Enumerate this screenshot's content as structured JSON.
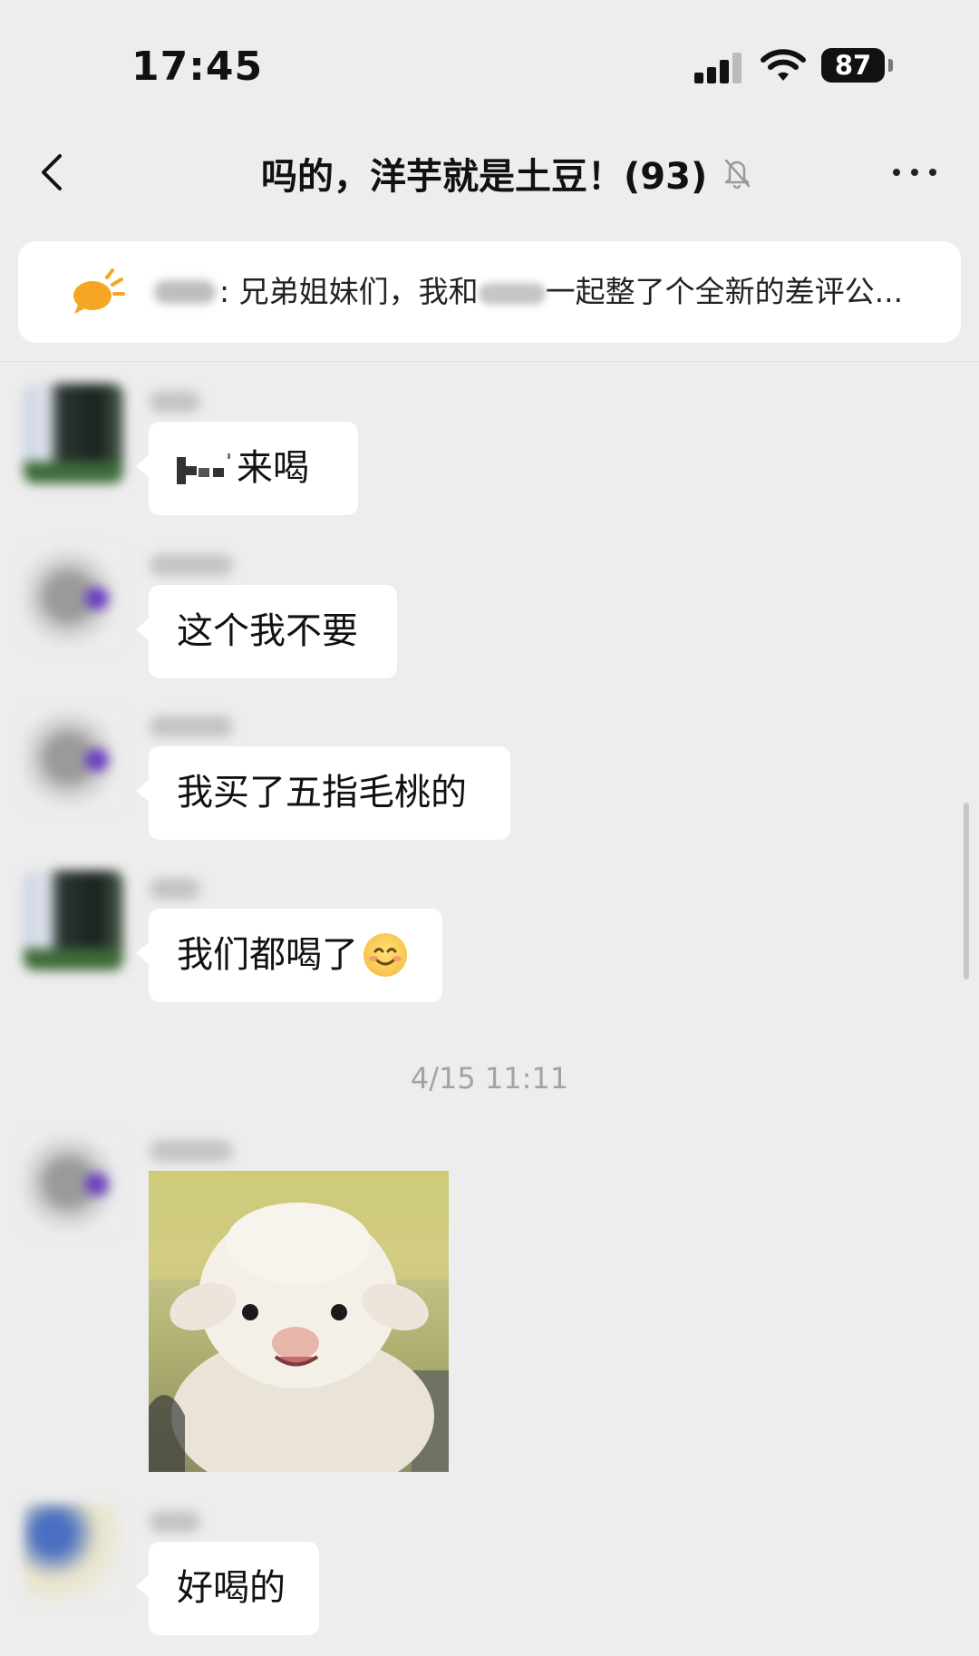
{
  "status_bar": {
    "time": "17:45",
    "battery": "87"
  },
  "nav": {
    "title": "吗的，洋芋就是土豆！(93)"
  },
  "announcement": {
    "text_part1": ": 兄弟姐妹们，我和",
    "text_part2": "一起整了个全新的差评公..."
  },
  "messages": [
    {
      "text": "来喝"
    },
    {
      "text": "这个我不要"
    },
    {
      "text": "我买了五指毛桃的"
    },
    {
      "text": "我们都喝了"
    },
    {
      "timestamp": "4/15 11:11"
    },
    {
      "image": "sheep-photo"
    },
    {
      "text": "好喝的"
    }
  ]
}
